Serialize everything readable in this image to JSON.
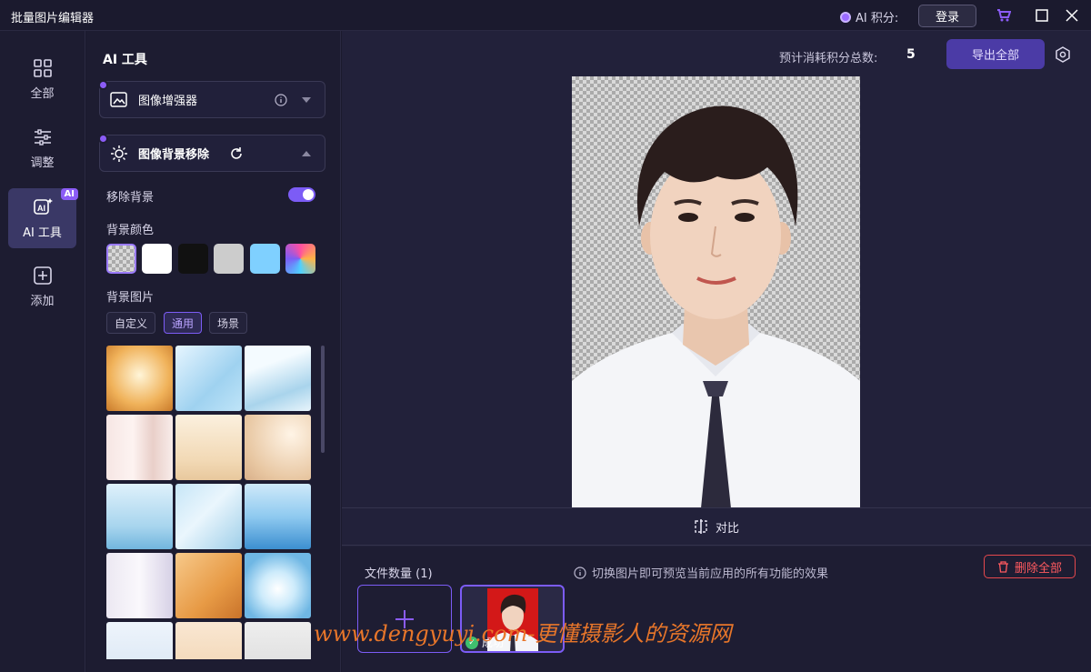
{
  "window": {
    "title": "批量图片编辑器",
    "points_label": "AI 积分:",
    "login_label": "登录",
    "icons": [
      "cart-icon",
      "maximize-icon",
      "close-icon"
    ]
  },
  "nav": {
    "items": [
      {
        "label": "全部",
        "icon": "grid-icon"
      },
      {
        "label": "调整",
        "icon": "sliders-icon"
      },
      {
        "label": "AI 工具",
        "icon": "ai-icon",
        "badge": "AI",
        "active": true
      },
      {
        "label": "添加",
        "icon": "plus-square-icon"
      }
    ]
  },
  "panel": {
    "title": "AI 工具",
    "tools": [
      {
        "label": "图像增强器",
        "icon": "image-enhance-icon",
        "expanded": false
      },
      {
        "label": "图像背景移除",
        "icon": "bg-remove-icon",
        "expanded": true
      }
    ],
    "remove_bg_label": "移除背景",
    "remove_bg_on": true,
    "bg_color_label": "背景颜色",
    "bg_colors": [
      "transparent",
      "#ffffff",
      "#111111",
      "#cccccc",
      "#7fd0ff",
      "gradient"
    ],
    "bg_image_label": "背景图片",
    "bg_image_tabs": [
      "自定义",
      "通用",
      "场景"
    ],
    "bg_image_tab_active": "通用"
  },
  "main": {
    "total_label": "预计消耗积分总数:",
    "total_value": "5",
    "export_label": "导出全部",
    "compare_label": "对比",
    "file_count_label": "文件数量 (1)",
    "hint_text": "切换图片即可预览当前应用的所有功能的效果",
    "delete_all_label": "删除全部",
    "file_status": "成功"
  },
  "watermark": "www.dengyuyi.com-更懂摄影人的资源网",
  "colors": {
    "accent": "#7c5cf6",
    "background": "#1b1a2e",
    "danger": "#e5484d",
    "success": "#3fbf6e"
  }
}
